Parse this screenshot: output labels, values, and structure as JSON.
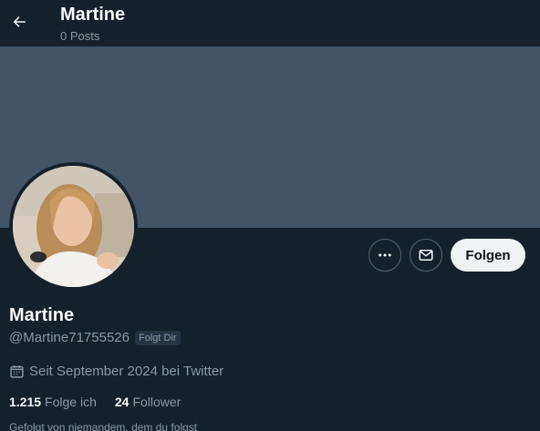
{
  "header": {
    "back_icon": "arrow-left-icon",
    "title": "Martine",
    "post_count": "0 Posts"
  },
  "profile": {
    "name": "Martine",
    "handle": "@Martine71755526",
    "follows_you_badge": "Folgt Dir",
    "joined": "Seit September 2024 bei Twitter",
    "joined_icon": "calendar-icon",
    "following_count": "1.215",
    "following_label": "Folge ich",
    "followers_count": "24",
    "followers_label": "Follower",
    "followed_by_text": "Gefolgt von niemandem, dem du folgst"
  },
  "actions": {
    "more_icon": "more-icon",
    "message_icon": "mail-icon",
    "follow_label": "Folgen"
  },
  "colors": {
    "background": "#15202b",
    "banner": "#425466",
    "secondary_text": "#8b98a5",
    "follow_button": "#eff3f4"
  }
}
